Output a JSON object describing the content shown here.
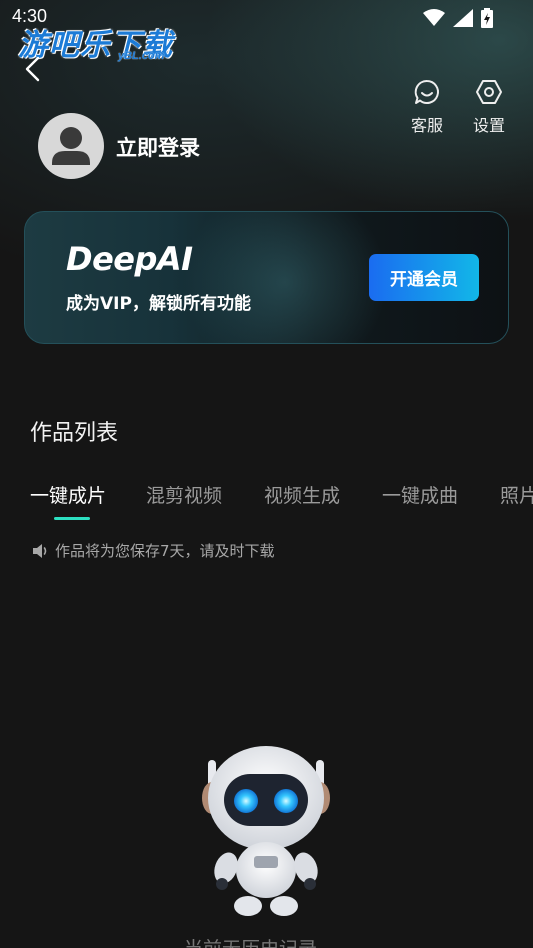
{
  "status_bar": {
    "time": "4:30"
  },
  "watermark": {
    "main": "游吧乐下载",
    "sub": "yBL.com"
  },
  "header": {
    "back_icon": "chevron-left-icon",
    "customer_service_label": "客服",
    "settings_label": "设置"
  },
  "profile": {
    "login_label": "立即登录"
  },
  "vip_card": {
    "brand": "DeepAI",
    "description": "成为VIP，解锁所有功能",
    "button_label": "开通会员",
    "button_gradient": [
      "#1a6cf0",
      "#12b7e8"
    ]
  },
  "works": {
    "title": "作品列表",
    "tabs": [
      "一键成片",
      "混剪视频",
      "视频生成",
      "一键成曲",
      "照片"
    ],
    "active_tab": 0,
    "accent_color": "#2de0c2",
    "notice": "作品将为您保存7天，请及时下载",
    "empty_text": "当前无历史记录"
  }
}
